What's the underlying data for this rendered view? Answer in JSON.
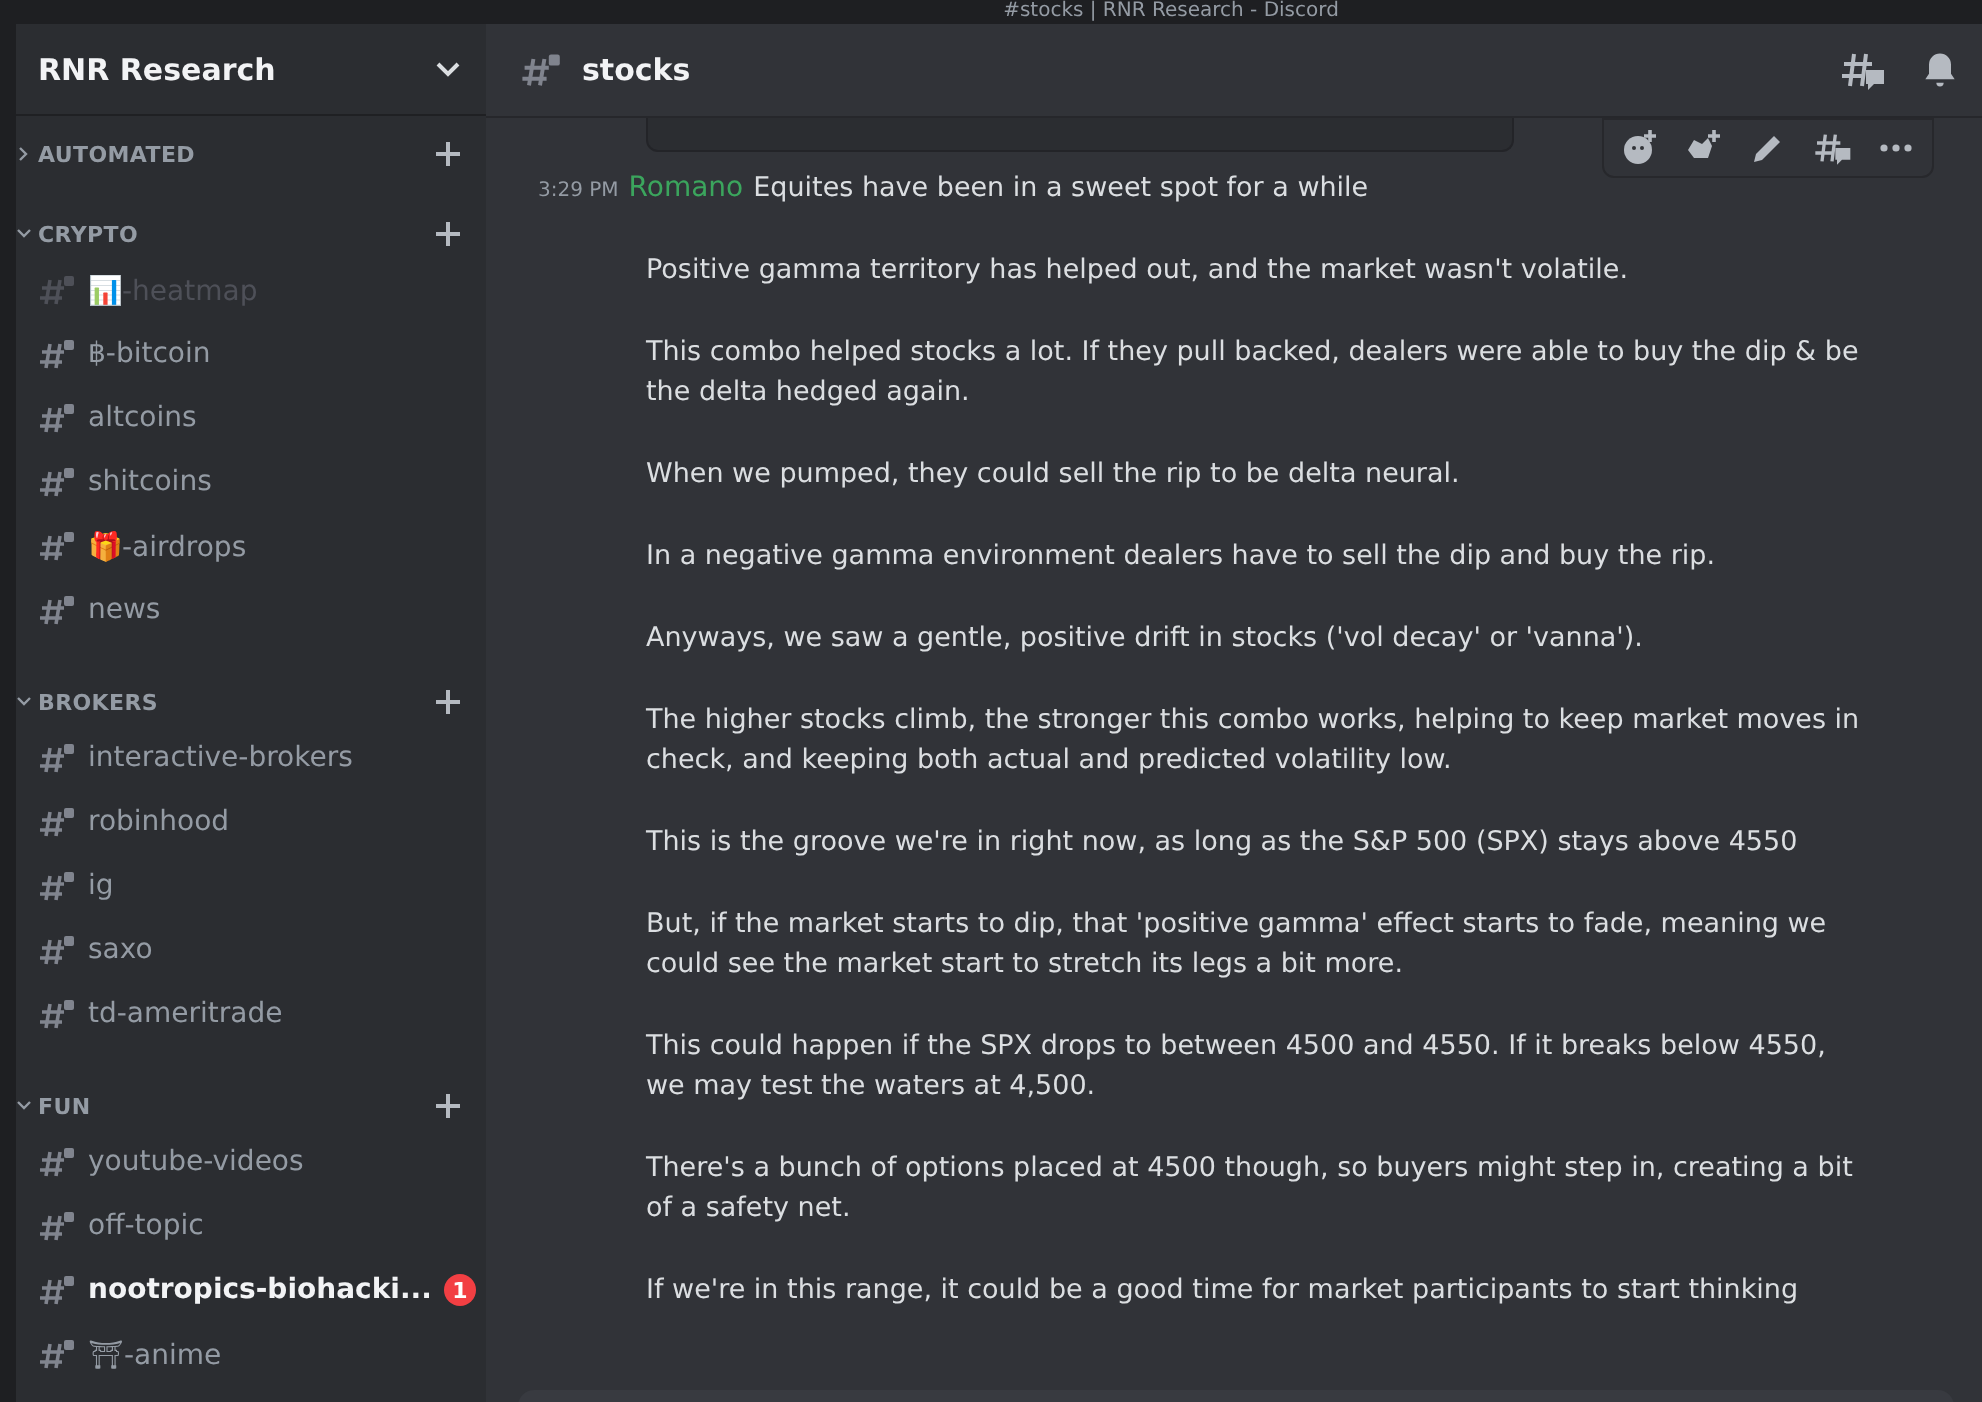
{
  "window": {
    "title": "#stocks | RNR Research - Discord"
  },
  "server": {
    "name": "RNR Research"
  },
  "categories": [
    {
      "name": "AUTOMATED",
      "expanded": false
    },
    {
      "name": "CRYPTO",
      "expanded": true,
      "channels": [
        {
          "emoji": "📊",
          "name": "-heatmap",
          "muted": true,
          "unread": false
        },
        {
          "name": "฿-bitcoin",
          "muted": false,
          "unread": false
        },
        {
          "name": "altcoins",
          "muted": false,
          "unread": false
        },
        {
          "name": "shitcoins",
          "muted": false,
          "unread": false
        },
        {
          "emoji": "🎁",
          "name": "-airdrops",
          "muted": false,
          "unread": false
        },
        {
          "name": "news",
          "muted": false,
          "unread": false
        }
      ]
    },
    {
      "name": "BROKERS",
      "expanded": true,
      "channels": [
        {
          "name": "interactive-brokers",
          "muted": false,
          "unread": false
        },
        {
          "name": "robinhood",
          "muted": false,
          "unread": false
        },
        {
          "name": "ig",
          "muted": false,
          "unread": false
        },
        {
          "name": "saxo",
          "muted": false,
          "unread": false
        },
        {
          "name": "td-ameritrade",
          "muted": false,
          "unread": false
        }
      ]
    },
    {
      "name": "FUN",
      "expanded": true,
      "channels": [
        {
          "name": "youtube-videos",
          "muted": false,
          "unread": false
        },
        {
          "name": "off-topic",
          "muted": false,
          "unread": false
        },
        {
          "name": "nootropics-biohacki...",
          "muted": false,
          "unread": true,
          "badge": "1"
        },
        {
          "name": "⛩-anime",
          "muted": false,
          "unread": false
        }
      ]
    }
  ],
  "channel_header": {
    "name": "stocks"
  },
  "message": {
    "time": "3:29 PM",
    "author": "Romano",
    "first_line": "Equites have been in a sweet spot for a while",
    "paragraphs": [
      "Positive gamma territory has helped out, and the market wasn't volatile.",
      "This combo helped stocks a lot. If they pull backed, dealers were able to buy the dip & be the delta hedged again.",
      "When we pumped, they could sell the rip to be delta neural.",
      "In a negative gamma environment dealers have to sell the dip and buy the rip.",
      "Anyways, we saw a gentle, positive drift in stocks ('vol decay' or 'vanna').",
      "The higher stocks climb, the stronger this combo works, helping to keep market moves in check, and keeping both actual and predicted volatility low.",
      "This is the groove we're in right now, as long as the S&P 500 (SPX) stays above 4550",
      "But, if the market starts to dip, that 'positive gamma' effect starts to fade, meaning we could see the market start to stretch its legs a bit more.",
      "This could happen if the SPX drops to between 4500 and 4550. If it breaks below 4550, we may test the waters at 4,500.",
      "There's a bunch of options placed at 4500 though, so buyers might step in, creating a bit of a safety net.",
      "If we're in this range, it could be a good time for market participants to start thinking"
    ]
  }
}
